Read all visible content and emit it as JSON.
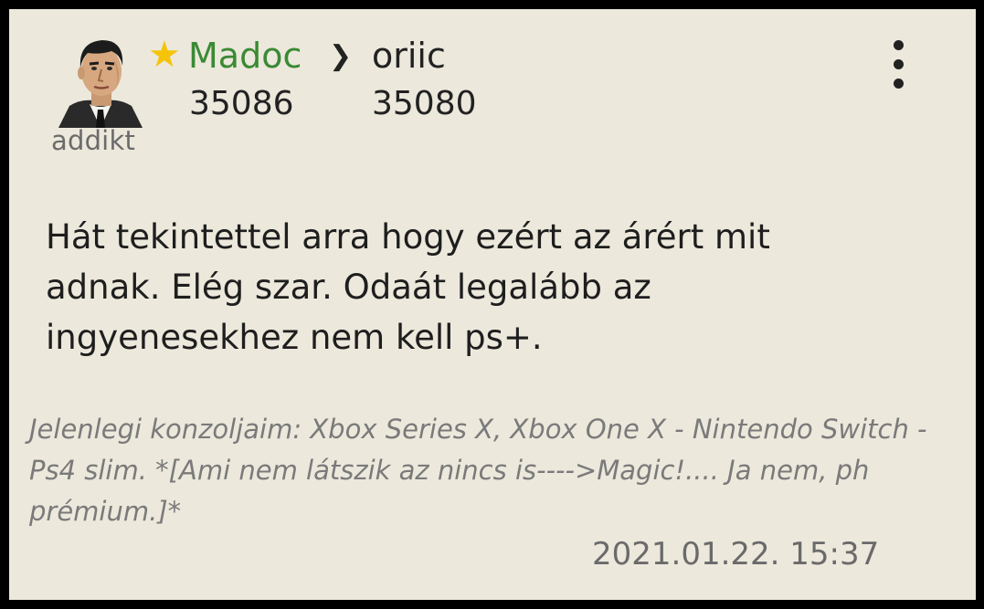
{
  "post": {
    "author": {
      "name": "Madoc",
      "rank": "addikt",
      "star_icon": "star-icon",
      "star_color": "#f5c40a",
      "name_color": "#3a8a34"
    },
    "reply_arrow": "❯",
    "reply_to": "oriic",
    "post_number": "35086",
    "reply_number": "35080",
    "menu_icon": "more-vertical-icon",
    "body": "Hát tekintettel arra hogy ezért az árért mit adnak. Elég szar. Odaát legalább az ingyenesekhez nem kell ps+.",
    "signature": "Jelenlegi konzoljaim: Xbox Series X, Xbox One X - Nintendo Switch - Ps4 slim. *[Ami nem látszik az nincs is---->Magic!.... Ja nem, ph prémium.]*",
    "timestamp": "2021.01.22. 15:37"
  },
  "colors": {
    "card_background": "#ece8dc",
    "frame": "#000000"
  }
}
